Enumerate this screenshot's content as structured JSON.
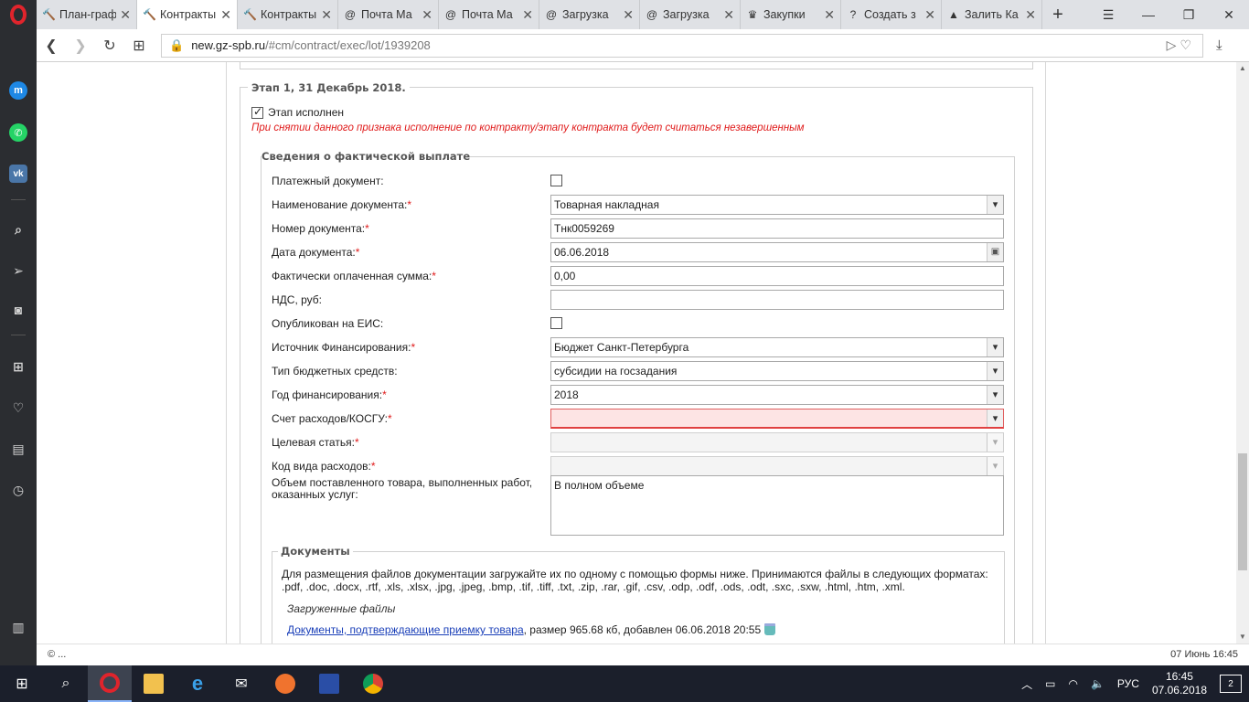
{
  "browser": {
    "tabs": [
      {
        "label": "План-граф",
        "icon": "gavel-icon"
      },
      {
        "label": "Контракты",
        "icon": "gavel-icon",
        "active": true
      },
      {
        "label": "Контракты",
        "icon": "gavel-icon"
      },
      {
        "label": "Почта Ма",
        "icon": "mail-at-icon"
      },
      {
        "label": "Почта Ма",
        "icon": "mail-at-icon"
      },
      {
        "label": "Загрузка",
        "icon": "mail-at-icon"
      },
      {
        "label": "Загрузка",
        "icon": "mail-at-icon"
      },
      {
        "label": "Закупки",
        "icon": "emblem-icon"
      },
      {
        "label": "Создать з",
        "icon": "help-icon"
      },
      {
        "label": "Залить Ка",
        "icon": "image-icon"
      }
    ],
    "url_host": "new.gz-spb.ru",
    "url_path": "/#cm/contract/exec/lot/1939208"
  },
  "stage": {
    "legend": "Этап 1, 31 Декабрь 2018.",
    "done_label": "Этап исполнен",
    "done_checked": true,
    "warning": "При снятии данного признака исполнение по контракту/этапу контракта будет считаться незавершенным"
  },
  "payment": {
    "legend": "Сведения о фактической выплате",
    "fields": [
      {
        "label": "Платежный документ:",
        "required": false,
        "type": "checkbox",
        "value": ""
      },
      {
        "label": "Наименование документа:",
        "required": true,
        "type": "select",
        "value": "Товарная накладная"
      },
      {
        "label": "Номер документа:",
        "required": true,
        "type": "text",
        "value": "Тнк0059269"
      },
      {
        "label": "Дата документа:",
        "required": true,
        "type": "date",
        "value": "06.06.2018"
      },
      {
        "label": "Фактически оплаченная сумма:",
        "required": true,
        "type": "text",
        "value": "0,00"
      },
      {
        "label": "НДС, руб:",
        "required": false,
        "type": "text",
        "value": ""
      },
      {
        "label": "Опубликован на ЕИС:",
        "required": false,
        "type": "checkbox",
        "value": ""
      },
      {
        "label": "Источник Финансирования:",
        "required": true,
        "type": "select",
        "value": "Бюджет Санкт-Петербурга"
      },
      {
        "label": "Тип бюджетных средств:",
        "required": false,
        "type": "select",
        "value": "субсидии на госзадания"
      },
      {
        "label": "Год финансирования:",
        "required": true,
        "type": "select",
        "value": "2018"
      },
      {
        "label": "Счет расходов/КОСГУ:",
        "required": true,
        "type": "select-error",
        "value": ""
      },
      {
        "label": "Целевая статья:",
        "required": true,
        "type": "select-disabled",
        "value": ""
      },
      {
        "label": "Код вида расходов:",
        "required": true,
        "type": "select-disabled",
        "value": ""
      }
    ],
    "volume_label_1": "Объем поставленного товара, выполненных работ,",
    "volume_label_2": "оказанных услуг:",
    "volume_value": "В полном объеме"
  },
  "documents": {
    "legend": "Документы",
    "info_line_1": "Для размещения файлов документации загружайте их по одному с помощью формы ниже. Принимаются файлы в следующих форматах:",
    "info_line_2": ".pdf, .doc, .docx, .rtf, .xls, .xlsx, .jpg, .jpeg, .bmp, .tif, .tiff, .txt, .zip, .rar, .gif, .csv, .odp, .odf, .ods, .odt, .sxc, .sxw, .html, .htm, .xml.",
    "uploaded_title": "Загруженные файлы",
    "file_link": "Документы, подтверждающие приемку товара",
    "file_meta": ", размер 965.68 кб, добавлен 06.06.2018 20:55"
  },
  "statusbar": {
    "left": "© ...",
    "right": "07 Июнь 16:45"
  },
  "taskbar": {
    "lang": "РУС",
    "time": "16:45",
    "date": "07.06.2018",
    "notifications": "2"
  },
  "colors": {
    "required_star": "#e01b1b",
    "warning_text": "#e01b1b",
    "link": "#1a3fb8",
    "error_field_bg": "#fde4e4"
  }
}
